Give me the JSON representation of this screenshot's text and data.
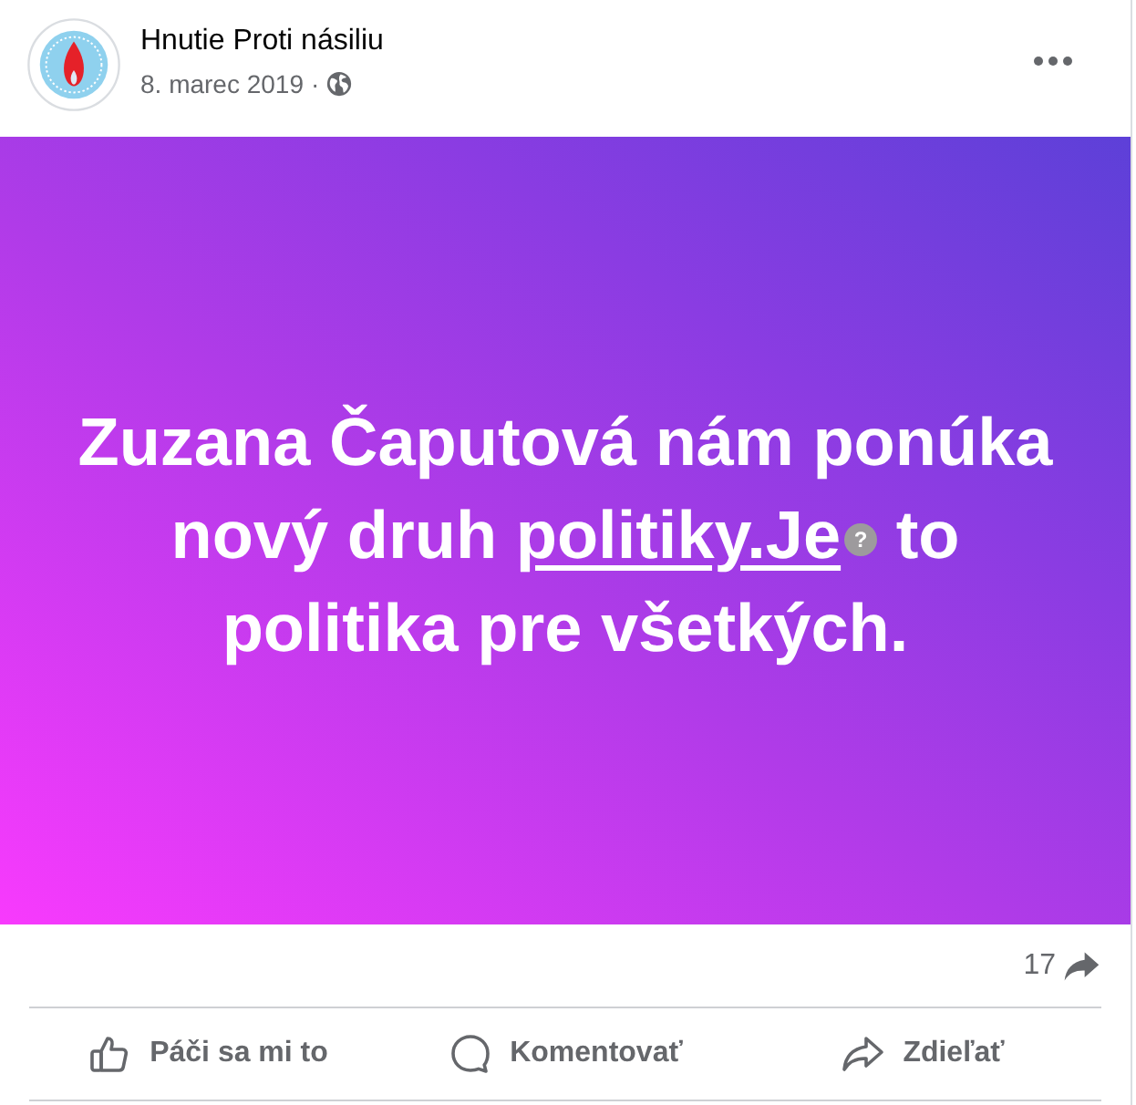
{
  "post": {
    "author": "Hnutie Proti násiliu",
    "date": "8. marec 2019",
    "separator": "·"
  },
  "banner": {
    "text_before": "Zuzana Čaputová nám ponúka nový druh ",
    "link": "politiky.Je",
    "missing_emoji": "?",
    "text_after": " to politika pre všetkých."
  },
  "stats": {
    "shares": "17"
  },
  "actions": [
    {
      "kind": "like",
      "label": "Páči sa mi to"
    },
    {
      "kind": "comment",
      "label": "Komentovať"
    },
    {
      "kind": "share",
      "label": "Zdieľať"
    }
  ]
}
